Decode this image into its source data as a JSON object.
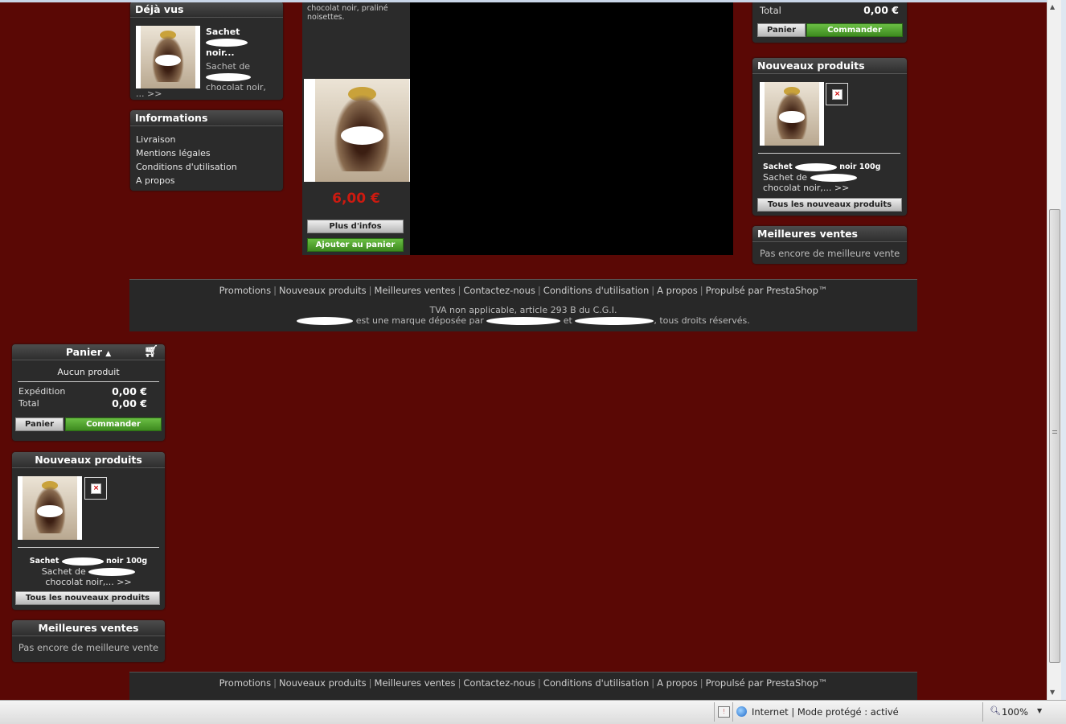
{
  "deja_vus": {
    "title": "Déjà vus",
    "product_name": "Sachet",
    "product_name2": "noir...",
    "desc1": "Sachet de",
    "desc2": "chocolat noir,",
    "more": "... >>"
  },
  "informations": {
    "title": "Informations",
    "items": [
      "Livraison",
      "Mentions légales",
      "Conditions d'utilisation",
      "A propos"
    ]
  },
  "product_center": {
    "desc_line1": "chocolat noir, praliné",
    "desc_line2": "noisettes.",
    "price": "6,00 €",
    "more_info_button": "Plus d'infos",
    "add_to_cart_button": "Ajouter au panier"
  },
  "cart_right": {
    "total_label": "Total",
    "total_value": "0,00 €",
    "cart_button": "Panier",
    "order_button": "Commander"
  },
  "new_products_right": {
    "title": "Nouveaux produits",
    "product_name_a": "Sachet",
    "product_name_b": "noir 100g",
    "desc_a": "Sachet de",
    "desc_b": "chocolat noir,... >>",
    "all_button": "Tous les nouveaux produits"
  },
  "best_sales_right": {
    "title": "Meilleures ventes",
    "empty": "Pas encore de meilleure vente"
  },
  "footer": {
    "links": [
      "Promotions",
      "Nouveaux produits",
      "Meilleures ventes",
      "Contactez-nous",
      "Conditions d'utilisation",
      "A propos",
      "Propulsé par PrestaShop™"
    ],
    "tva": "TVA non applicable, article 293 B du C.G.I.",
    "trademark_mid": "est une marque déposée par",
    "trademark_and": "et",
    "trademark_end": ", tous droits réservés."
  },
  "cart_left": {
    "title": "Panier",
    "empty": "Aucun produit",
    "shipping_label": "Expédition",
    "shipping_value": "0,00 €",
    "total_label": "Total",
    "total_value": "0,00 €",
    "cart_button": "Panier",
    "order_button": "Commander"
  },
  "new_products_left": {
    "title": "Nouveaux produits",
    "product_name_a": "Sachet",
    "product_name_b": "noir 100g",
    "desc_a": "Sachet de",
    "desc_b": "chocolat noir,... >>",
    "all_button": "Tous les nouveaux produits"
  },
  "best_sales_left": {
    "title": "Meilleures ventes",
    "empty": "Pas encore de meilleure vente"
  },
  "statusbar": {
    "zone": "Internet | Mode protégé : activé",
    "zoom": "100%"
  },
  "colors": {
    "background": "#5a0805",
    "block": "#2b2b2b",
    "price": "#cc1a10",
    "green_button": "#4a9a28"
  }
}
